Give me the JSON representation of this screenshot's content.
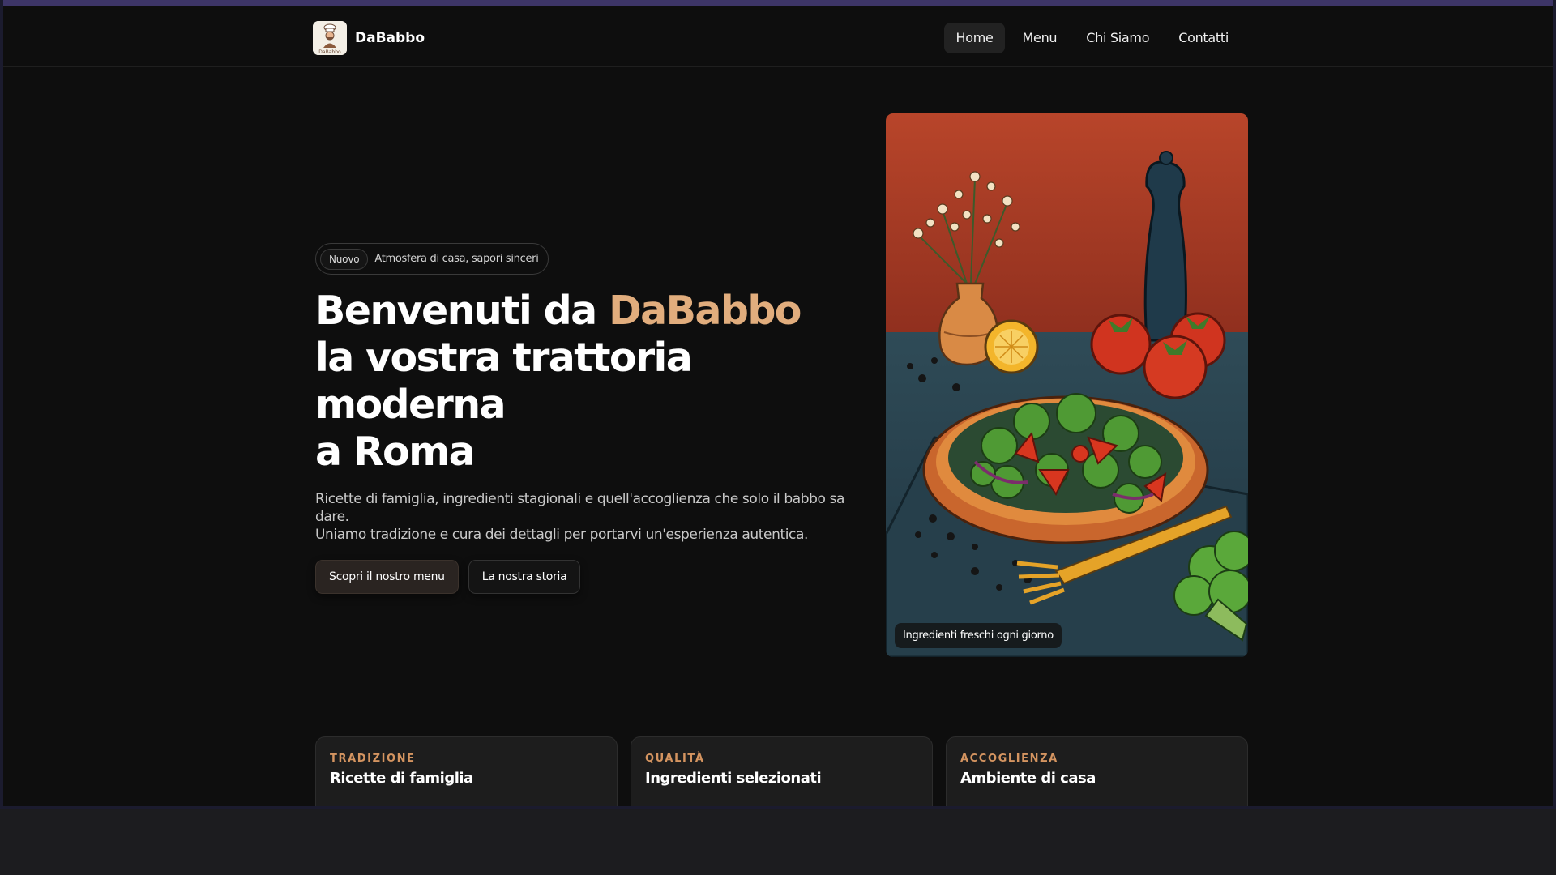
{
  "brand": {
    "name": "DaBabbo",
    "logo_icon": "chef-logo-icon",
    "logo_text": "DaBabbo"
  },
  "nav": {
    "items": [
      "Home",
      "Menu",
      "Chi Siamo",
      "Contatti"
    ],
    "active": "Home"
  },
  "hero": {
    "badge": "Nuovo",
    "badge_text": "Atmosfera di casa, sapori sinceri",
    "headline_line1_prefix": "Benvenuti da ",
    "headline_line1_accent": "DaBabbo",
    "headline_line2": "la vostra trattoria moderna",
    "headline_line3": "a Roma",
    "lead_line1": "Ricette di famiglia, ingredienti stagionali e quell'accoglienza che solo il babbo sa dare.",
    "lead_line2": "Uniamo tradizione e cura dei dettagli per portarvi un'esperienza autentica.",
    "cta_primary": "Scopri il nostro menu",
    "cta_secondary": "La nostra storia",
    "image_caption": "Ingredienti freschi ogni giorno",
    "image_subject": "illustration of a salad bowl with broccoli, tomatoes, lemon, flower vase, pepper mill and fork"
  },
  "features": [
    {
      "kicker": "TRADIZIONE",
      "title": "Ricette di famiglia"
    },
    {
      "kicker": "QUALITÀ",
      "title": "Ingredienti selezionati"
    },
    {
      "kicker": "ACCOGLIENZA",
      "title": "Ambiente di casa"
    }
  ],
  "colors": {
    "accent": "#e1ad7d",
    "kicker": "#d49460",
    "background": "#0e0e0e",
    "top_strip": "#3d3567"
  }
}
